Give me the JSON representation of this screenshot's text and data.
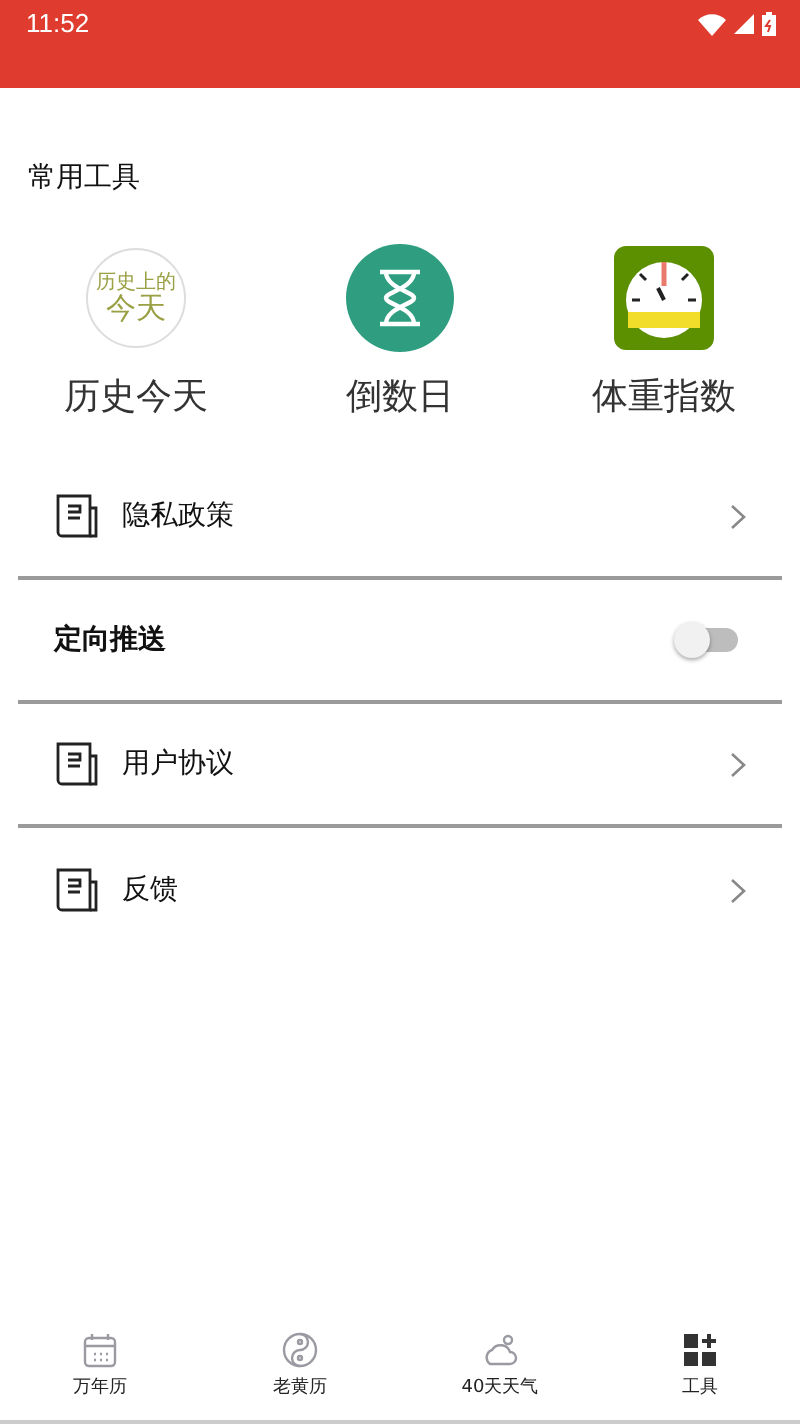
{
  "status_bar": {
    "time": "11:52"
  },
  "section": {
    "title": "常用工具"
  },
  "tools": [
    {
      "kind": "history",
      "label": "历史今天",
      "logo_caption": "历史上的",
      "logo_text": "今天"
    },
    {
      "kind": "countdown",
      "label": "倒数日"
    },
    {
      "kind": "scale",
      "label": "体重指数"
    }
  ],
  "settings": [
    {
      "kind": "link",
      "label": "隐私政策"
    },
    {
      "kind": "toggle",
      "label": "定向推送",
      "on": false
    },
    {
      "kind": "link",
      "label": "用户协议"
    },
    {
      "kind": "link",
      "label": "反馈"
    }
  ],
  "bottom_nav": [
    {
      "kind": "calendar",
      "label": "万年历",
      "selected": false
    },
    {
      "kind": "yinyang",
      "label": "老黄历",
      "selected": false
    },
    {
      "kind": "weather",
      "label": "40天天气",
      "selected": false
    },
    {
      "kind": "tools",
      "label": "工具",
      "selected": true
    }
  ]
}
